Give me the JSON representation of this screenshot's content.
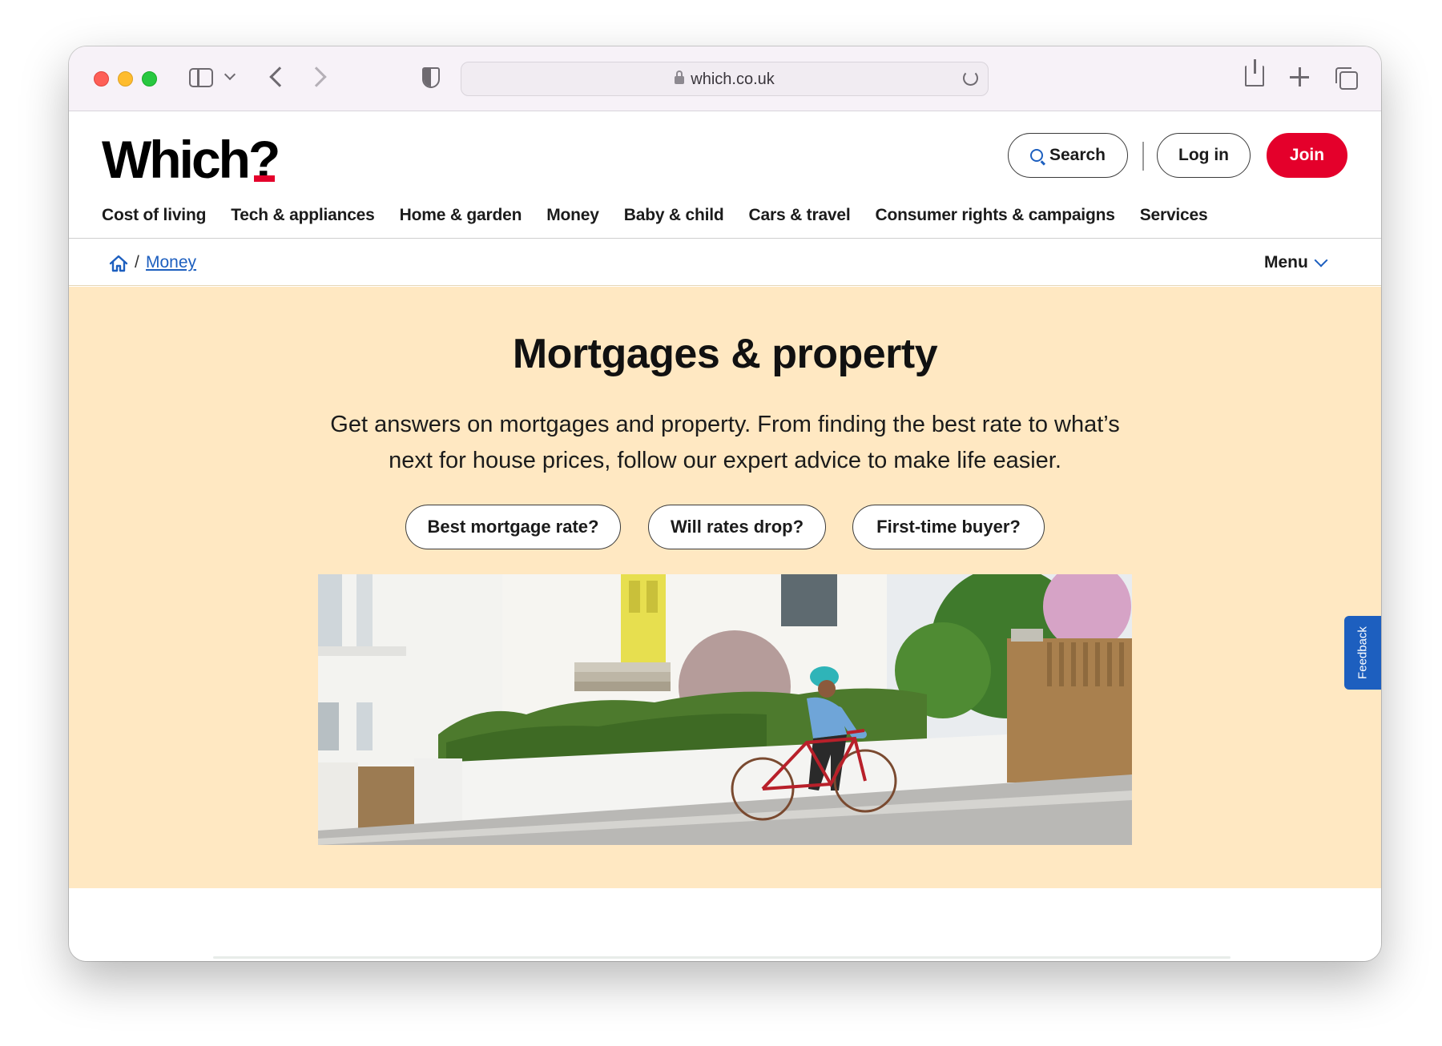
{
  "browser": {
    "url": "which.co.uk"
  },
  "header": {
    "logo": "Which?",
    "search_label": "Search",
    "login_label": "Log in",
    "join_label": "Join"
  },
  "nav": {
    "items": [
      "Cost of living",
      "Tech & appliances",
      "Home & garden",
      "Money",
      "Baby & child",
      "Cars & travel",
      "Consumer rights & campaigns",
      "Services"
    ]
  },
  "breadcrumb": {
    "separator": "/",
    "link": "Money",
    "menu_label": "Menu"
  },
  "hero": {
    "title": "Mortgages & property",
    "description": "Get answers on mortgages and property. From finding the best rate to what’s next for house prices, follow our expert advice to make life easier.",
    "chips": [
      "Best mortgage rate?",
      "Will rates drop?",
      "First-time buyer?"
    ]
  },
  "feedback_label": "Feedback",
  "colors": {
    "brand_red": "#e4002b",
    "link_blue": "#1d5fbf",
    "hero_bg": "#ffe8c2"
  }
}
